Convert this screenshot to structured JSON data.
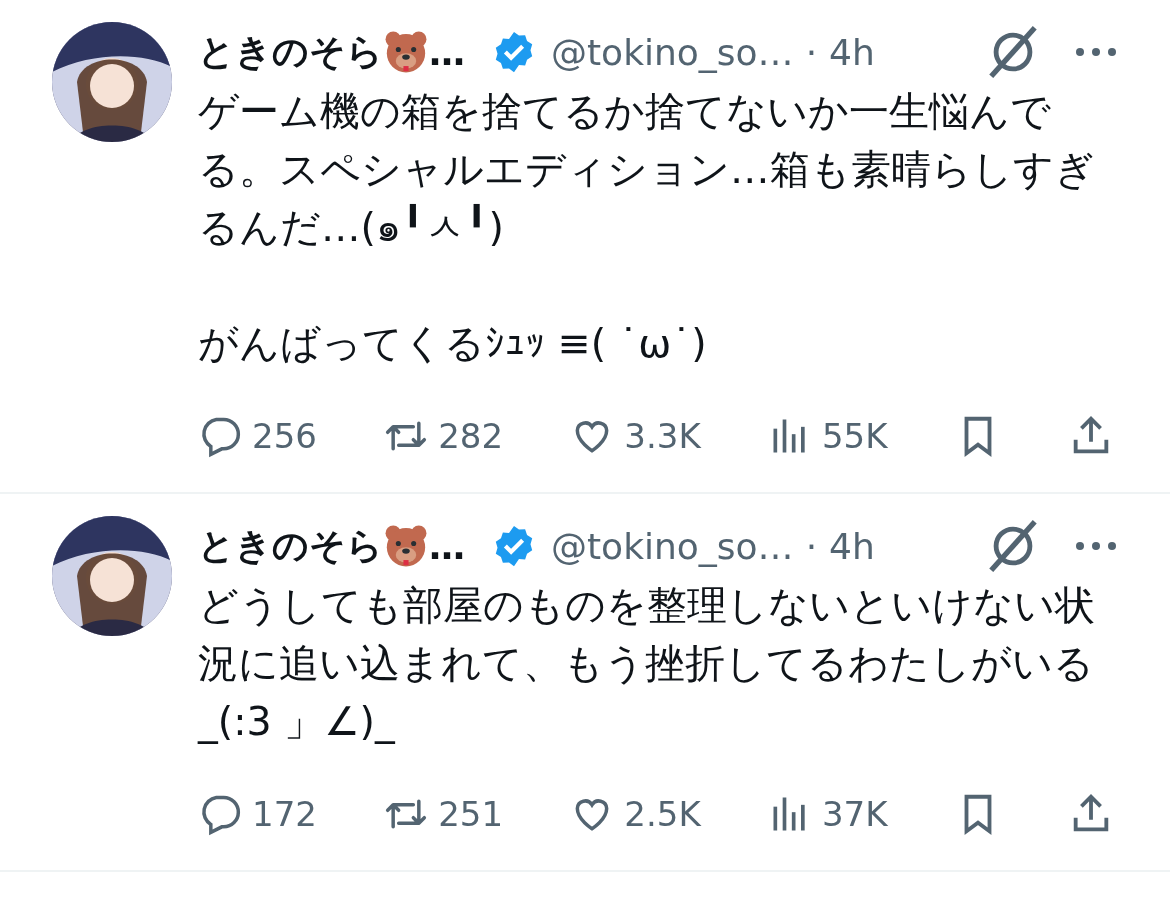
{
  "posts": [
    {
      "name": "ときのそら",
      "name_ellipsis": "…",
      "verified": true,
      "handle": "@tokino_so…",
      "separator": "·",
      "time": "4h",
      "text": "ゲーム機の箱を捨てるか捨てないか一生悩んでる。スペシャルエディション…箱も素晴らしすぎるんだ…(๑╹ㅅ╹)\n\nがんばってくるｼｭｯ ≡( ˙ω˙)",
      "replies": "256",
      "reposts": "282",
      "likes": "3.3K",
      "views": "55K"
    },
    {
      "name": "ときのそら",
      "name_ellipsis": "…",
      "verified": true,
      "handle": "@tokino_so…",
      "separator": "·",
      "time": "4h",
      "text": "どうしても部屋のものを整理しないといけない状況に追い込まれて、もう挫折してるわたしがいる_(:3 」∠)_",
      "replies": "172",
      "reposts": "251",
      "likes": "2.5K",
      "views": "37K"
    }
  ]
}
